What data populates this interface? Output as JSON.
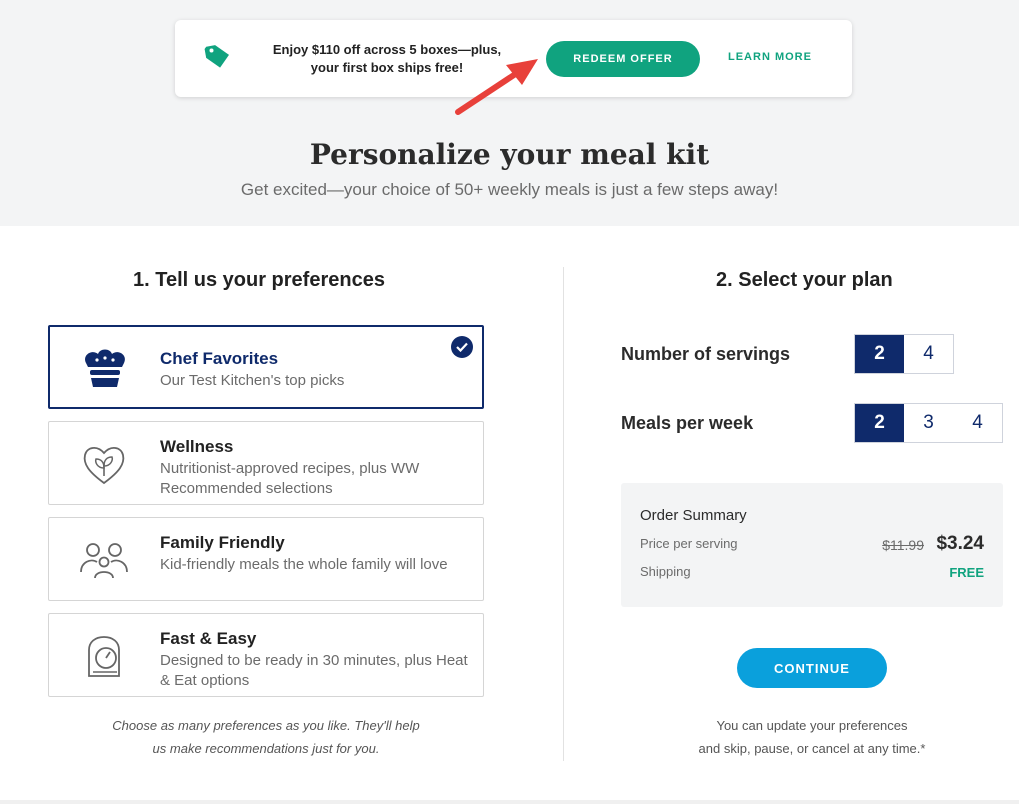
{
  "offer": {
    "text_line1": "Enjoy $110 off across 5 boxes—plus,",
    "text_line2": "your first box ships free!",
    "redeem_label": "REDEEM OFFER",
    "learn_label": "LEARN MORE"
  },
  "hero": {
    "title": "Personalize your meal kit",
    "subtitle": "Get excited—your choice of 50+ weekly meals is just a few steps away!"
  },
  "preferences": {
    "heading": "1. Tell us your preferences",
    "items": [
      {
        "name": "Chef Favorites",
        "desc": "Our Test Kitchen's top picks",
        "icon": "chef-hat-icon",
        "selected": true
      },
      {
        "name": "Wellness",
        "desc": "Nutritionist-approved recipes, plus WW Recommended selections",
        "icon": "heart-leaf-icon",
        "selected": false
      },
      {
        "name": "Family Friendly",
        "desc": "Kid-friendly meals the whole family will love",
        "icon": "family-icon",
        "selected": false
      },
      {
        "name": "Fast & Easy",
        "desc": "Designed to be ready in 30 minutes, plus Heat & Eat options",
        "icon": "timer-icon",
        "selected": false
      }
    ],
    "note_line1": "Choose as many preferences as you like. They'll help",
    "note_line2": "us make recommendations just for you."
  },
  "plan": {
    "heading": "2. Select your plan",
    "servings_label": "Number of servings",
    "servings_options": [
      "2",
      "4"
    ],
    "servings_selected": "2",
    "meals_label": "Meals per week",
    "meals_options": [
      "2",
      "3",
      "4"
    ],
    "meals_selected": "2",
    "summary": {
      "title": "Order Summary",
      "price_label": "Price per serving",
      "old_price": "$11.99",
      "new_price": "$3.24",
      "shipping_label": "Shipping",
      "shipping_value": "FREE"
    },
    "continue_label": "CONTINUE",
    "note_line1": "You can update your preferences",
    "note_line2": "and skip, pause, or cancel at any time.*"
  },
  "colors": {
    "navy": "#0f2a6b",
    "green": "#10a37f",
    "blue": "#0aa0dc",
    "arrow_red": "#e8403a"
  }
}
